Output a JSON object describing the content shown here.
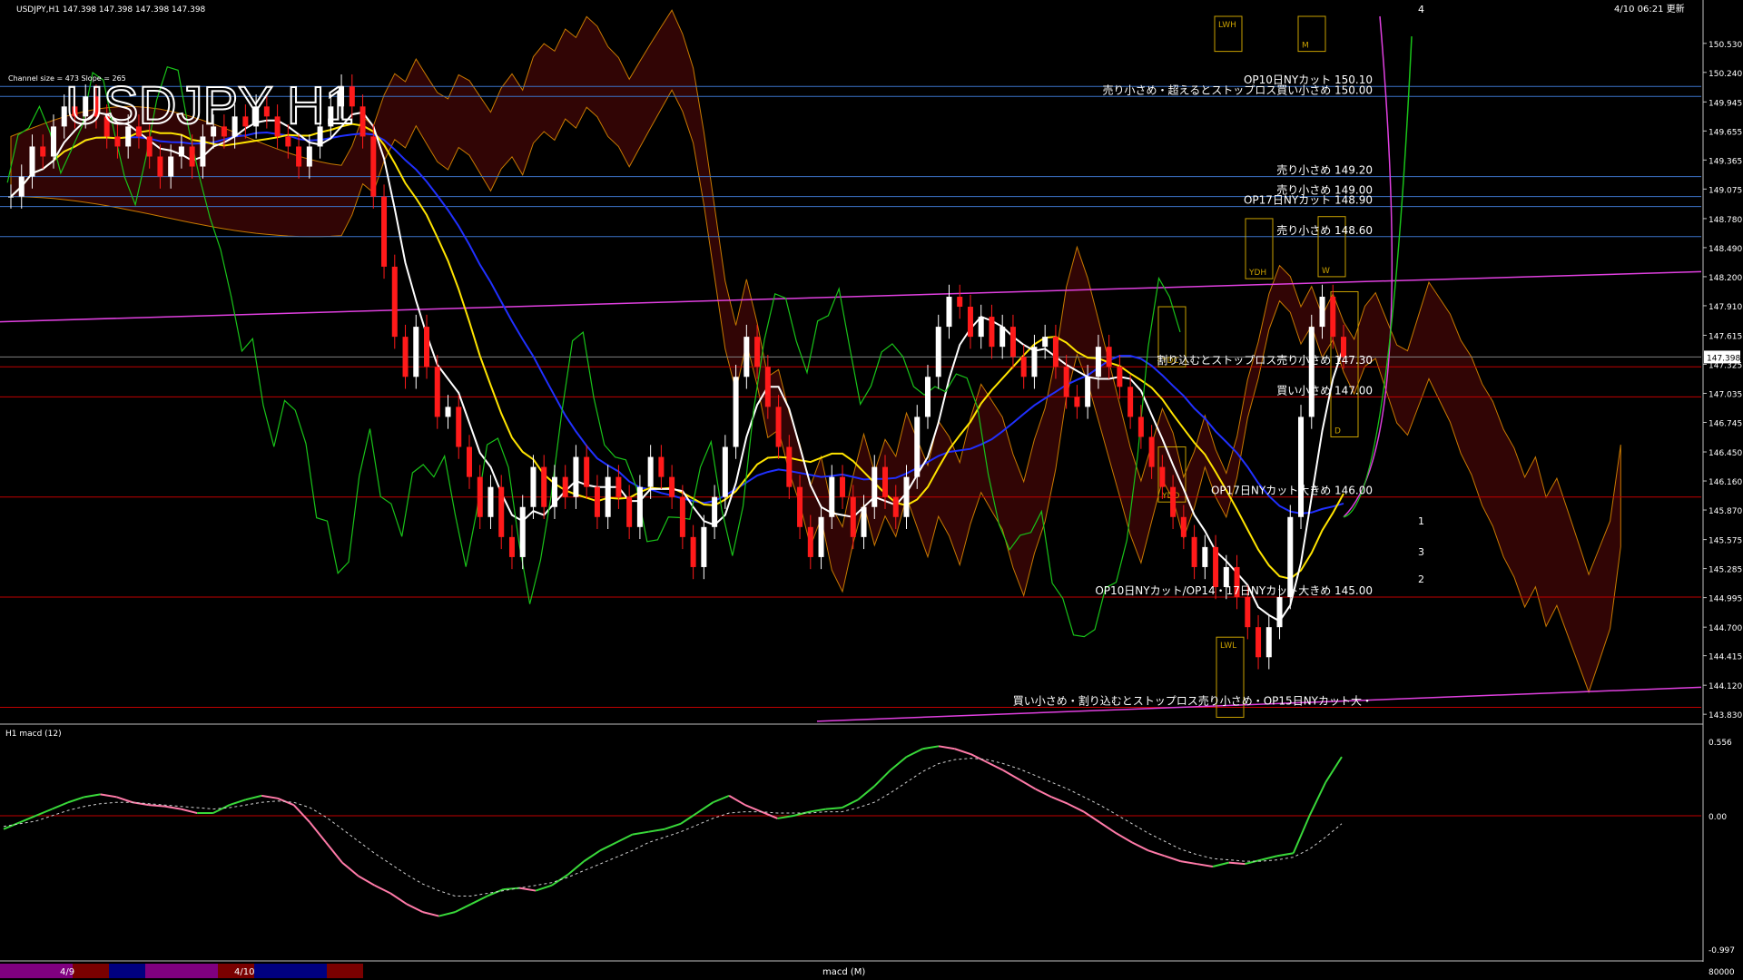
{
  "window": {
    "symbol_info": "USDJPY,H1  147.398 147.398 147.398 147.398",
    "timestamp": "4/10 06:21 更新",
    "big_title": "USDJPY H1",
    "channel_info": "Channel size = 473  Slope = 265"
  },
  "colors": {
    "background": "#000000",
    "grid_border": "#c0c0c0",
    "level_blue": "#3b73c8",
    "level_red": "#c00000",
    "trend_magenta": "#e040e0",
    "ma_yellow": "#ffe400",
    "ma_white": "#ffffff",
    "ma_blue": "#2030ff",
    "chikou_green": "#19c319",
    "macd_green": "#39d93a",
    "macd_pink": "#ff7aa8",
    "price_box": "#c8a000"
  },
  "chart_data": [
    {
      "type": "candlestick",
      "title": "USDJPY H1",
      "ylim": [
        143.75,
        150.8
      ],
      "y_ticks": [
        "150.530",
        "150.240",
        "149.945",
        "149.655",
        "149.365",
        "149.075",
        "148.780",
        "148.490",
        "148.200",
        "147.910",
        "147.615",
        "147.325",
        "147.035",
        "146.745",
        "146.450",
        "146.160",
        "145.870",
        "145.575",
        "145.285",
        "144.995",
        "144.700",
        "144.415",
        "144.120",
        "143.830"
      ],
      "current_price": "147.398",
      "levels": [
        {
          "price": 150.1,
          "label": "OP10日NYカット 150.10",
          "color": "#3b73c8"
        },
        {
          "price": 150.0,
          "label": "売り小さめ・超えるとストップロス買い小さめ 150.00",
          "color": "#3b73c8"
        },
        {
          "price": 149.2,
          "label": "売り小さめ 149.20",
          "color": "#3b73c8"
        },
        {
          "price": 149.0,
          "label": "売り小さめ 149.00",
          "color": "#3b73c8"
        },
        {
          "price": 148.9,
          "label": "OP17日NYカット 148.90",
          "color": "#3b73c8"
        },
        {
          "price": 148.6,
          "label": "売り小さめ 148.60",
          "color": "#3b73c8"
        },
        {
          "price": 147.3,
          "label": "割り込むとストップロス売り小さめ 147.30",
          "color": "#c00000"
        },
        {
          "price": 147.0,
          "label": "買い小さめ 147.00",
          "color": "#c00000"
        },
        {
          "price": 146.0,
          "label": "OP17日NYカット大きめ 146.00",
          "color": "#c00000"
        },
        {
          "price": 145.0,
          "label": "OP10日NYカット/OP14・17日NYカット大きめ 145.00",
          "color": "#c00000"
        },
        {
          "price": 143.9,
          "label": "買い小さめ・割り込むとストップロス売り小さめ・OP15日NYカット大・",
          "color": "#c00000"
        }
      ],
      "box_labels": [
        "LWH",
        "M",
        "YDH",
        "W",
        "YDC",
        "D",
        "YDO",
        "LWL"
      ],
      "projection_labels": [
        "4",
        "1",
        "3",
        "2"
      ],
      "closes": [
        149.0,
        149.2,
        149.5,
        149.4,
        149.7,
        149.9,
        149.8,
        150.0,
        149.8,
        149.6,
        149.5,
        149.7,
        149.6,
        149.4,
        149.2,
        149.4,
        149.5,
        149.3,
        149.6,
        149.7,
        149.6,
        149.8,
        149.7,
        149.9,
        149.8,
        149.6,
        149.5,
        149.3,
        149.5,
        149.7,
        149.9,
        150.1,
        149.9,
        149.6,
        149.0,
        148.3,
        147.6,
        147.2,
        147.7,
        147.3,
        146.8,
        146.9,
        146.5,
        146.2,
        145.8,
        146.1,
        145.6,
        145.4,
        145.9,
        146.3,
        145.9,
        146.2,
        146.0,
        146.4,
        146.1,
        145.8,
        146.2,
        146.0,
        145.7,
        146.1,
        146.4,
        146.2,
        146.0,
        145.6,
        145.3,
        145.7,
        146.0,
        146.5,
        147.2,
        147.6,
        147.3,
        146.9,
        146.5,
        146.1,
        145.7,
        145.4,
        145.8,
        146.2,
        146.0,
        145.6,
        145.9,
        146.3,
        146.0,
        145.8,
        146.2,
        146.8,
        147.2,
        147.7,
        148.0,
        147.9,
        147.6,
        147.8,
        147.5,
        147.7,
        147.4,
        147.2,
        147.5,
        147.6,
        147.3,
        147.0,
        146.9,
        147.2,
        147.5,
        147.3,
        147.1,
        146.8,
        146.6,
        146.3,
        146.1,
        145.8,
        145.6,
        145.3,
        145.5,
        145.1,
        145.3,
        145.0,
        144.7,
        144.4,
        144.7,
        145.0,
        145.8,
        146.8,
        147.7,
        148.0,
        147.6,
        147.4
      ],
      "macd_ylim": [
        -0.997,
        0.556
      ],
      "macd_ticks": [
        "0.556",
        "0.00",
        "-0.997"
      ],
      "macd_title": "H1  macd (12)",
      "macd_main": [
        -0.1,
        -0.05,
        0.0,
        0.05,
        0.1,
        0.14,
        0.16,
        0.14,
        0.1,
        0.08,
        0.07,
        0.05,
        0.02,
        0.02,
        0.08,
        0.12,
        0.15,
        0.13,
        0.08,
        -0.05,
        -0.2,
        -0.35,
        -0.45,
        -0.52,
        -0.58,
        -0.66,
        -0.72,
        -0.75,
        -0.72,
        -0.66,
        -0.6,
        -0.55,
        -0.54,
        -0.56,
        -0.52,
        -0.44,
        -0.34,
        -0.26,
        -0.2,
        -0.14,
        -0.12,
        -0.1,
        -0.06,
        0.02,
        0.1,
        0.15,
        0.08,
        0.03,
        -0.02,
        0.0,
        0.03,
        0.05,
        0.06,
        0.12,
        0.22,
        0.34,
        0.44,
        0.5,
        0.52,
        0.5,
        0.46,
        0.4,
        0.34,
        0.27,
        0.2,
        0.14,
        0.09,
        0.03,
        -0.05,
        -0.13,
        -0.2,
        -0.26,
        -0.3,
        -0.34,
        -0.36,
        -0.38,
        -0.35,
        -0.36,
        -0.33,
        -0.3,
        -0.28,
        0.0,
        0.25,
        0.44
      ],
      "macd_signal": [
        -0.08,
        -0.06,
        -0.04,
        0.0,
        0.04,
        0.07,
        0.09,
        0.1,
        0.1,
        0.09,
        0.08,
        0.07,
        0.06,
        0.05,
        0.06,
        0.08,
        0.1,
        0.11,
        0.1,
        0.06,
        -0.01,
        -0.1,
        -0.19,
        -0.28,
        -0.36,
        -0.44,
        -0.51,
        -0.56,
        -0.6,
        -0.6,
        -0.58,
        -0.56,
        -0.54,
        -0.52,
        -0.5,
        -0.46,
        -0.41,
        -0.36,
        -0.31,
        -0.26,
        -0.2,
        -0.16,
        -0.12,
        -0.07,
        -0.02,
        0.02,
        0.03,
        0.03,
        0.02,
        0.02,
        0.02,
        0.03,
        0.03,
        0.06,
        0.1,
        0.17,
        0.25,
        0.33,
        0.39,
        0.42,
        0.43,
        0.42,
        0.39,
        0.35,
        0.3,
        0.25,
        0.2,
        0.14,
        0.08,
        0.01,
        -0.06,
        -0.13,
        -0.19,
        -0.25,
        -0.29,
        -0.32,
        -0.33,
        -0.34,
        -0.34,
        -0.33,
        -0.31,
        -0.25,
        -0.16,
        -0.06
      ],
      "bottom_labels": [
        "4/9",
        "4/10",
        "macd (M)"
      ],
      "bottom_tick_value": "80000"
    }
  ]
}
